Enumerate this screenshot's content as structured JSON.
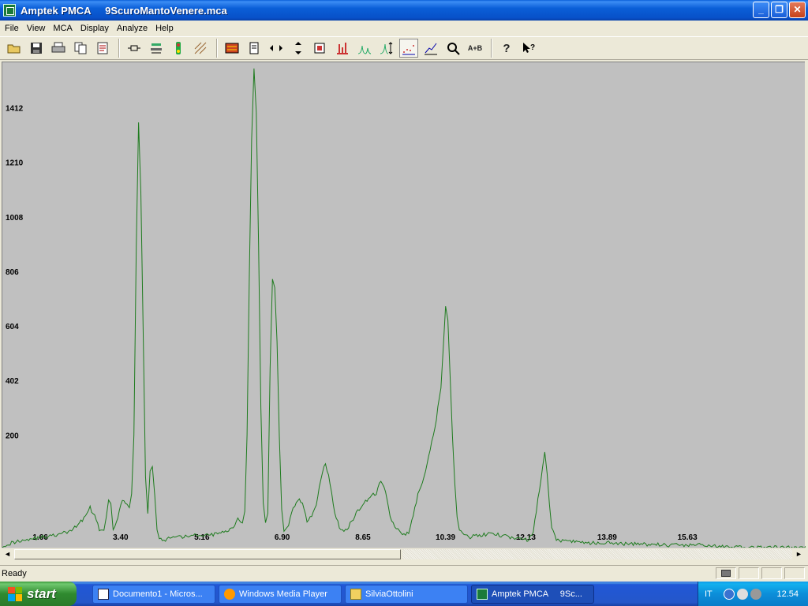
{
  "window": {
    "title": "Amptek PMCA     9ScuroMantoVenere.mca",
    "minimize_label": "_",
    "maximize_label": "❐",
    "close_label": "✕"
  },
  "menu": [
    "File",
    "View",
    "MCA",
    "Display",
    "Analyze",
    "Help"
  ],
  "toolbar": {
    "icons": [
      "open-icon",
      "save-icon",
      "print-icon",
      "copy-icon",
      "report-icon",
      "acquire-icon",
      "settings-icon",
      "roi-icon",
      "calibrate-icon",
      "color-icon",
      "page-icon",
      "horizontal-zoom-icon",
      "vertical-zoom-icon",
      "fit-icon",
      "bar-icon",
      "peak-icon",
      "autoscale-icon",
      "points-icon",
      "line-icon",
      "zoom-icon",
      "compare-icon",
      "help-icon",
      "context-help-icon"
    ],
    "compare_label": "A+B"
  },
  "chart_data": {
    "type": "line",
    "title": "",
    "xlabel": "",
    "ylabel": "",
    "color": "#1e7b1e",
    "background": "#c0c0c0",
    "x_ticks": [
      "1.66",
      "3.40",
      "5.16",
      "6.90",
      "8.65",
      "10.39",
      "12.13",
      "13.89",
      "15.63"
    ],
    "y_ticks": [
      "1412",
      "1210",
      "1008",
      "806",
      "604",
      "402",
      "200"
    ],
    "ylim": [
      -220,
      1580
    ],
    "xlim": [
      0.8,
      18.2
    ],
    "x": [
      0.8,
      1.0,
      1.2,
      1.4,
      1.6,
      1.8,
      2.0,
      2.2,
      2.4,
      2.6,
      2.7,
      2.8,
      2.9,
      3.0,
      3.05,
      3.1,
      3.15,
      3.2,
      3.3,
      3.4,
      3.5,
      3.55,
      3.6,
      3.65,
      3.7,
      3.75,
      3.8,
      3.85,
      3.9,
      3.95,
      4.0,
      4.05,
      4.1,
      4.15,
      4.2,
      4.3,
      4.4,
      4.6,
      4.8,
      5.0,
      5.2,
      5.4,
      5.6,
      5.8,
      5.9,
      6.0,
      6.05,
      6.1,
      6.15,
      6.2,
      6.25,
      6.3,
      6.35,
      6.4,
      6.45,
      6.5,
      6.55,
      6.6,
      6.65,
      6.7,
      6.75,
      6.8,
      6.85,
      6.9,
      6.95,
      7.0,
      7.1,
      7.2,
      7.3,
      7.4,
      7.5,
      7.6,
      7.7,
      7.8,
      7.9,
      8.0,
      8.1,
      8.2,
      8.3,
      8.4,
      8.5,
      8.6,
      8.7,
      8.8,
      8.9,
      9.0,
      9.1,
      9.2,
      9.3,
      9.4,
      9.5,
      9.6,
      9.7,
      9.8,
      9.9,
      10.0,
      10.1,
      10.2,
      10.3,
      10.35,
      10.4,
      10.45,
      10.5,
      10.55,
      10.6,
      10.65,
      10.7,
      10.8,
      10.9,
      11.0,
      11.2,
      11.4,
      11.6,
      11.8,
      12.0,
      12.2,
      12.3,
      12.4,
      12.5,
      12.55,
      12.6,
      12.65,
      12.7,
      12.8,
      12.9,
      13.0,
      13.2,
      13.4,
      13.6,
      13.8,
      14.0,
      14.2,
      14.4,
      14.6,
      14.8,
      15.0,
      15.2,
      15.4,
      15.6,
      15.8,
      16.0,
      16.4,
      16.8,
      17.2,
      17.6,
      18.0,
      18.2
    ],
    "y": [
      -210,
      -200,
      -190,
      -185,
      -180,
      -175,
      -170,
      -160,
      -140,
      -100,
      -70,
      -100,
      -150,
      -160,
      -110,
      -40,
      -60,
      -150,
      -110,
      -40,
      -60,
      -70,
      -20,
      200,
      900,
      1360,
      1100,
      600,
      50,
      -90,
      60,
      80,
      -20,
      -150,
      -180,
      -190,
      -185,
      -180,
      -175,
      -172,
      -170,
      -168,
      -160,
      -140,
      -110,
      -130,
      -80,
      200,
      800,
      1300,
      1560,
      1400,
      900,
      300,
      -50,
      -130,
      -90,
      450,
      780,
      750,
      550,
      200,
      -80,
      -150,
      -140,
      -130,
      -70,
      -40,
      -50,
      -120,
      -100,
      -60,
      40,
      100,
      20,
      -90,
      -140,
      -160,
      -140,
      -110,
      -80,
      -60,
      -40,
      -20,
      -15,
      30,
      -10,
      -100,
      -140,
      -160,
      -170,
      -160,
      -100,
      -20,
      20,
      90,
      170,
      260,
      380,
      520,
      680,
      620,
      420,
      200,
      20,
      -110,
      -150,
      -170,
      -180,
      -175,
      -170,
      -165,
      -172,
      -178,
      -182,
      -190,
      -160,
      -40,
      80,
      130,
      60,
      -60,
      -150,
      -185,
      -190,
      -192,
      -195,
      -198,
      -200,
      -200,
      -198,
      -202,
      -205,
      -200,
      -206,
      -204,
      -208,
      -206,
      -210,
      -205,
      -210,
      -212,
      -215,
      -218,
      -215,
      -218,
      -212
    ]
  },
  "scrollbar": {
    "left_arrow": "◄",
    "right_arrow": "►"
  },
  "status": {
    "message": "Ready"
  },
  "taskbar": {
    "start_label": "start",
    "tasks": [
      {
        "label": "Documento1 - Micros..."
      },
      {
        "label": "Windows Media Player"
      },
      {
        "label": "SilviaOttolini"
      },
      {
        "label": "Amptek PMCA     9Sc..."
      }
    ],
    "language": "IT",
    "clock": "12.54"
  }
}
